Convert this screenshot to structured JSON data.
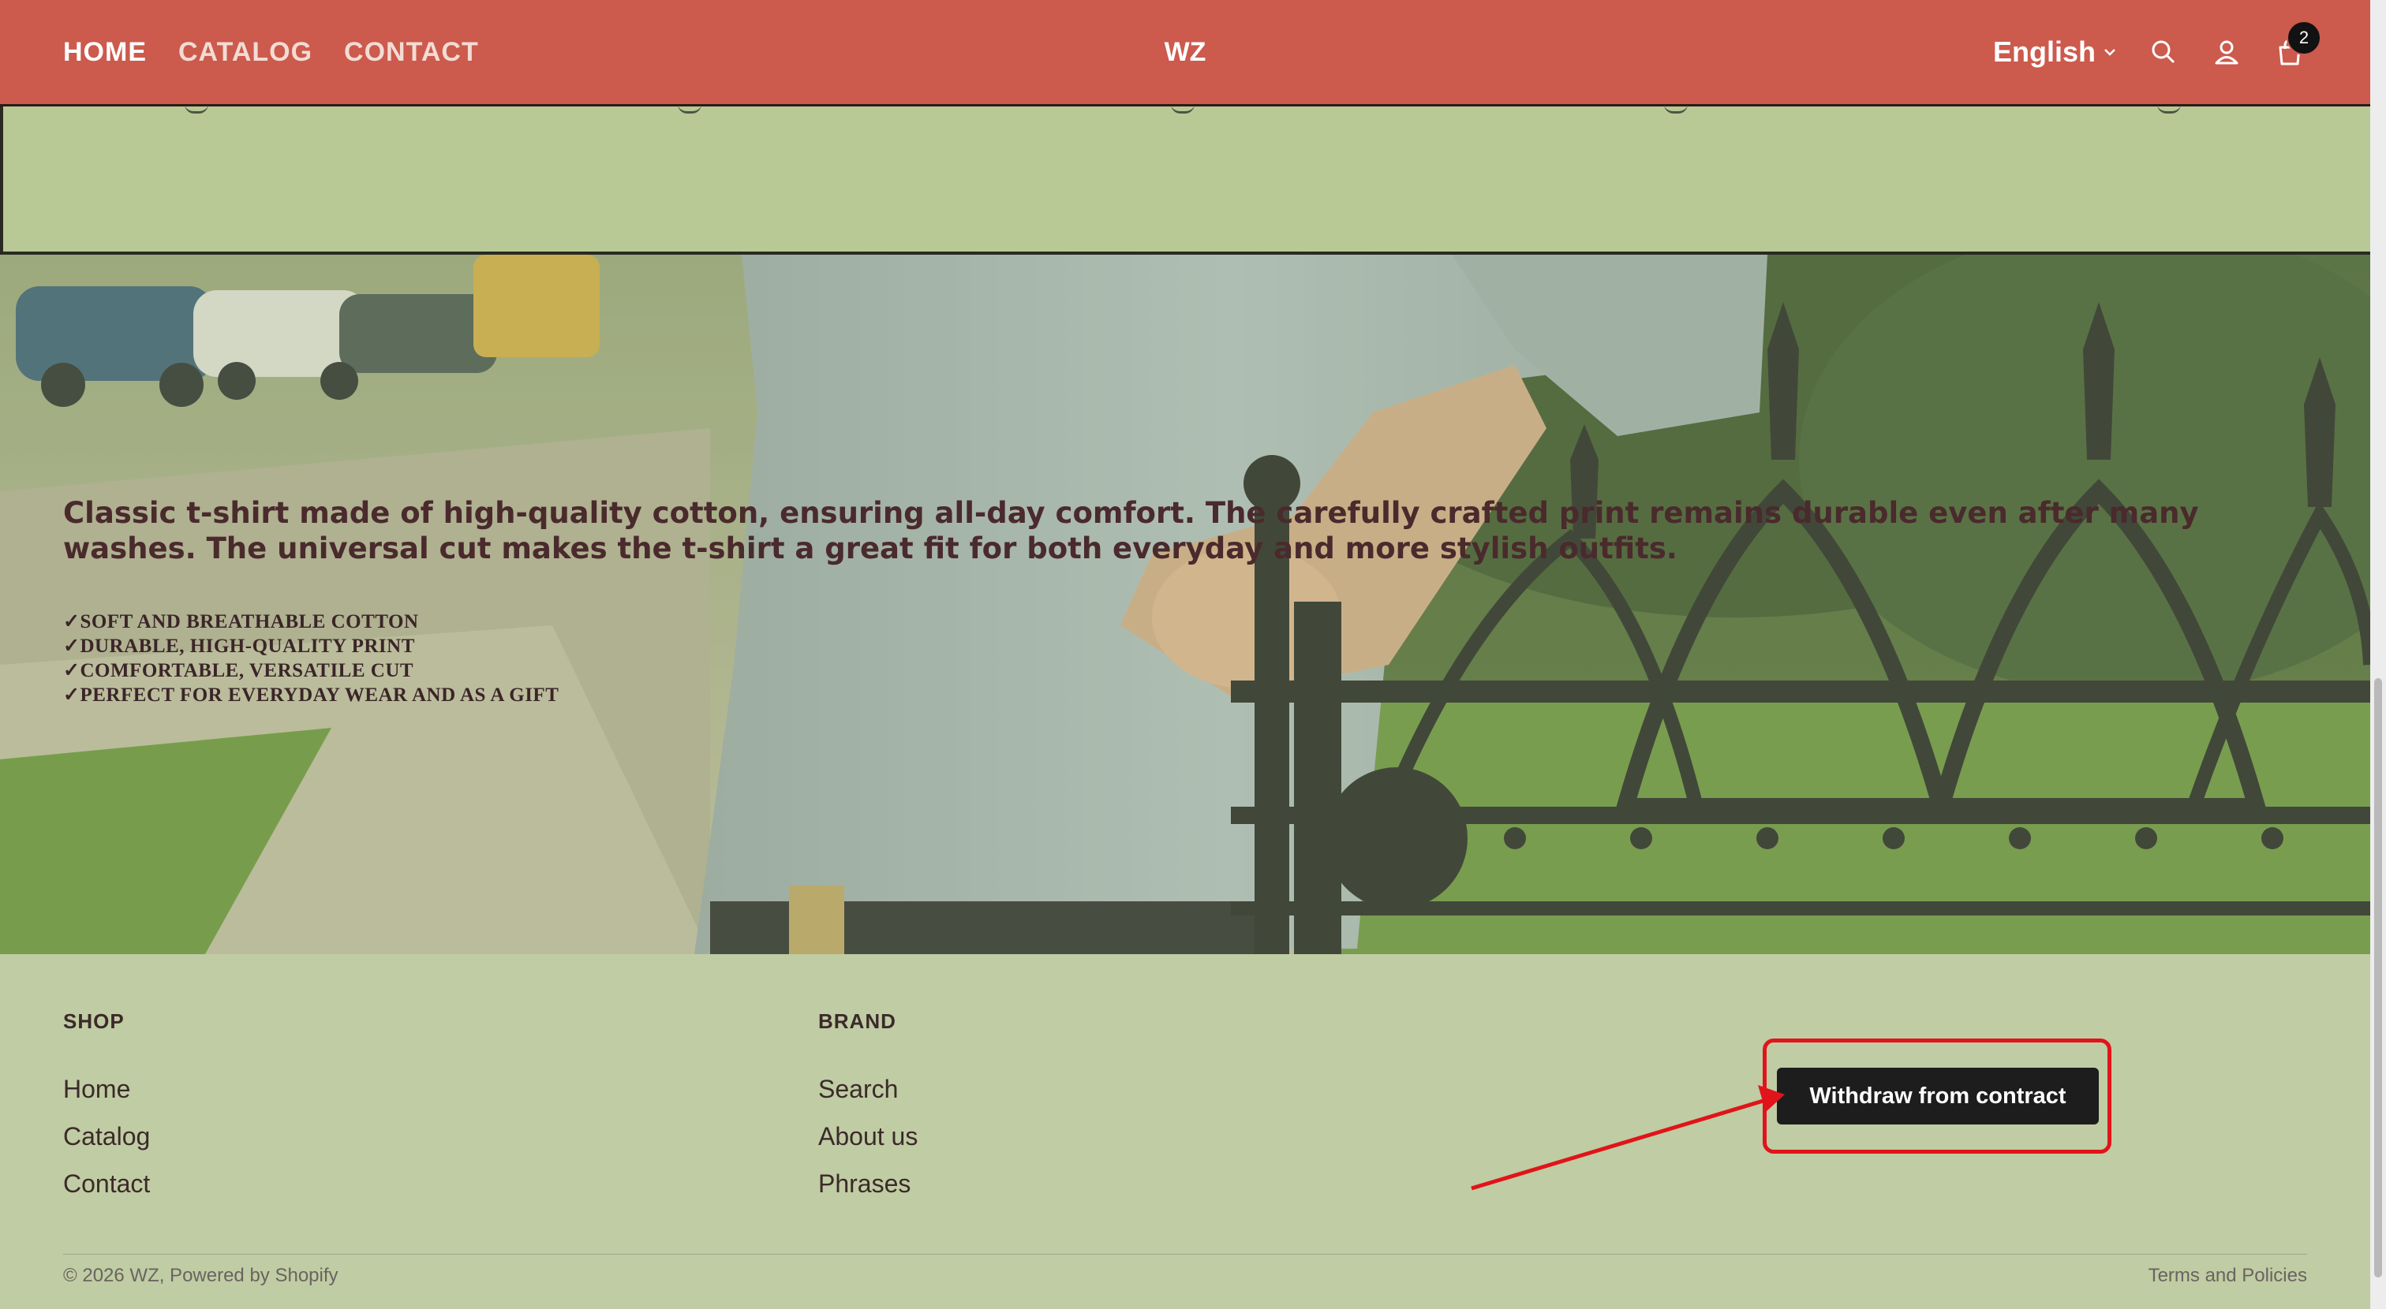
{
  "header": {
    "nav": [
      "HOME",
      "CATALOG",
      "CONTACT"
    ],
    "brand": "WZ",
    "language": "English",
    "cart_count": "2"
  },
  "hero": {
    "description": "Classic t-shirt made of high-quality cotton, ensuring all-day comfort. The carefully crafted print remains durable even after many washes. The universal cut makes the t-shirt a great fit for both everyday and more stylish outfits.",
    "features": [
      "✓SOFT AND BREATHABLE COTTON",
      "✓DURABLE, HIGH-QUALITY PRINT",
      "✓COMFORTABLE, VERSATILE CUT",
      "✓PERFECT FOR EVERYDAY WEAR AND AS A GIFT"
    ]
  },
  "footer": {
    "shop": {
      "heading": "SHOP",
      "links": [
        "Home",
        "Catalog",
        "Contact"
      ]
    },
    "brand": {
      "heading": "BRAND",
      "links": [
        "Search",
        "About us",
        "Phrases"
      ]
    },
    "withdraw_button": "Withdraw from contract",
    "copyright": "© 2026 WZ, Powered by Shopify",
    "policies": "Terms and Policies"
  },
  "colors": {
    "header_bg": "#cc5a4d",
    "page_bg": "#c0cca3",
    "band_bg": "#b8c996",
    "annotation": "#e0141a"
  }
}
